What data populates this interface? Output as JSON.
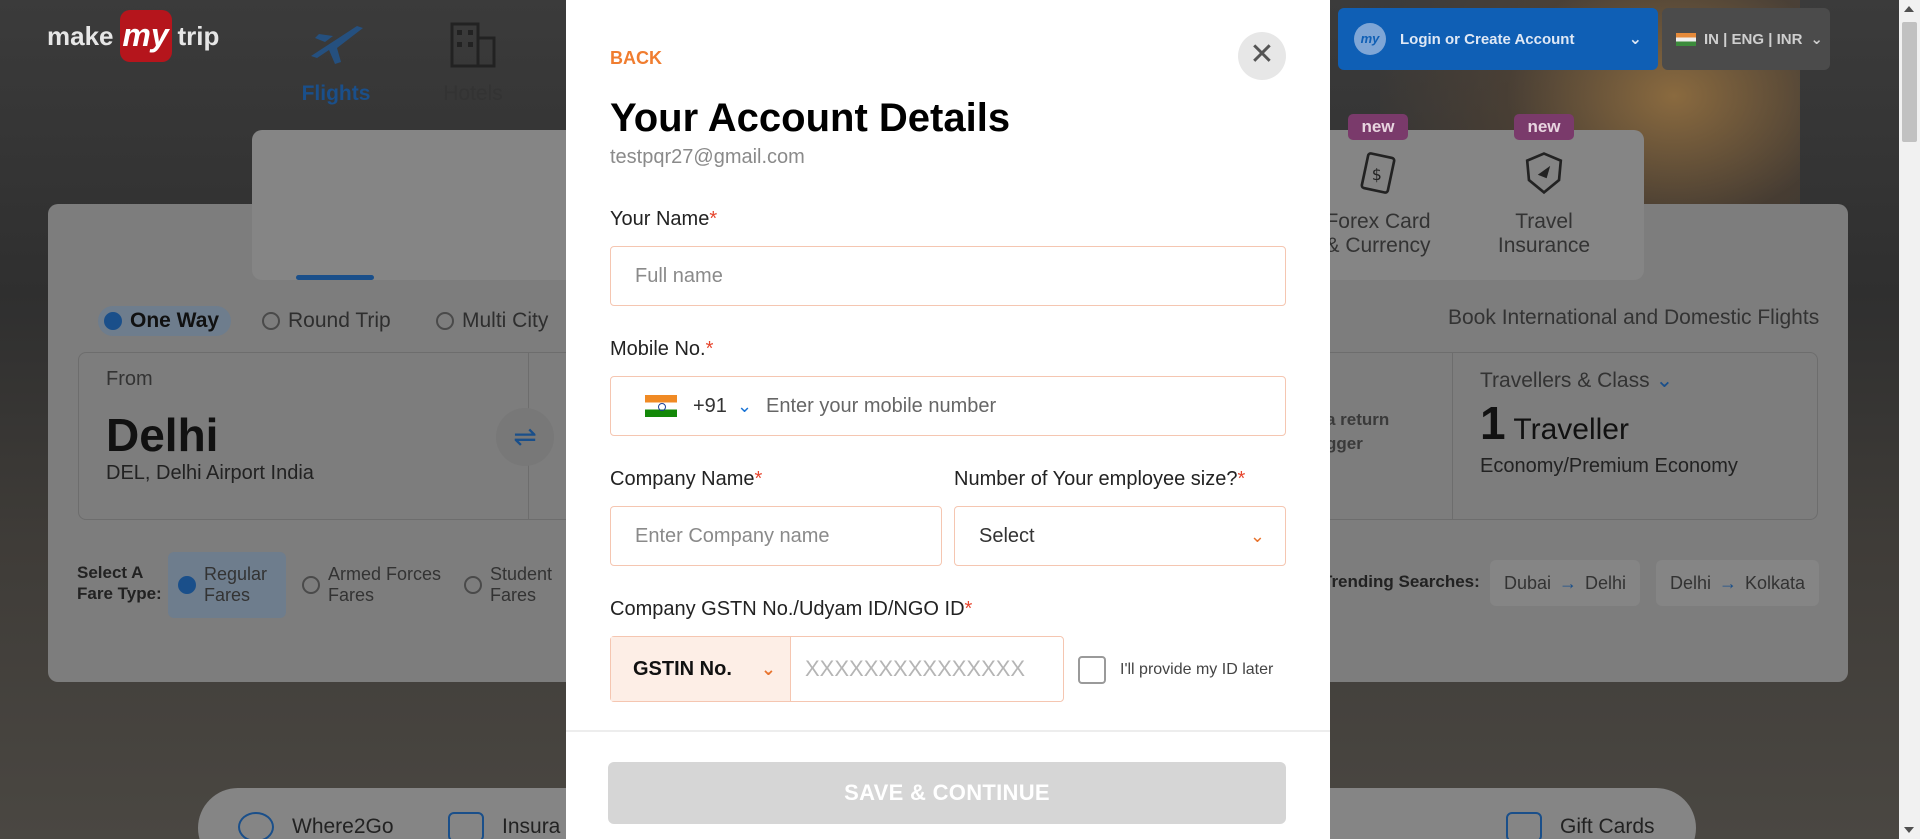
{
  "background": {
    "logo": {
      "left": "make",
      "mid": "my",
      "right": "trip"
    },
    "login": {
      "label": "Login or Create Account",
      "icon_text": "my"
    },
    "locale": {
      "label": "IN | ENG | INR"
    },
    "tabs": [
      {
        "label": "Flights"
      },
      {
        "label": "Hotels"
      }
    ],
    "tabs_right": [
      {
        "label_line1": "Forex Card",
        "label_line2": "& Currency",
        "badge": "new"
      },
      {
        "label_line1": "Travel",
        "label_line2": "Insurance",
        "badge": "new"
      }
    ],
    "trip_types": [
      "One Way",
      "Round Trip",
      "Multi City"
    ],
    "book_intl": "Book International and Domestic Flights",
    "from": {
      "label": "From",
      "city": "Delhi",
      "sub": "DEL, Delhi Airport India"
    },
    "return_hint": {
      "line1": "a return",
      "line2": "gger"
    },
    "travellers": {
      "label": "Travellers & Class",
      "count": "1",
      "unit": "Traveller",
      "class": "Economy/Premium Economy"
    },
    "fare": {
      "label_line1": "Select A",
      "label_line2": "Fare Type:",
      "options": [
        {
          "line1": "Regular",
          "line2": "Fares"
        },
        {
          "line1": "Armed Forces",
          "line2": "Fares"
        },
        {
          "line1": "Student",
          "line2": "Fares"
        }
      ]
    },
    "trending": {
      "label": "Trending Searches:",
      "chips": [
        {
          "from": "Dubai",
          "to": "Delhi"
        },
        {
          "from": "Delhi",
          "to": "Kolkata"
        }
      ]
    },
    "bottom": [
      {
        "label": "Where2Go"
      },
      {
        "label": "Insura"
      },
      {
        "label": "Gift Cards"
      }
    ],
    "arrow": "→"
  },
  "modal": {
    "back": "BACK",
    "close": "✕",
    "title": "Your Account Details",
    "email": "testpqr27@gmail.com",
    "name_label": "Your Name",
    "name_placeholder": "Full name",
    "mobile_label": "Mobile No.",
    "country_code": "+91",
    "mobile_placeholder": "Enter your mobile number",
    "company_label": "Company Name",
    "company_placeholder": "Enter Company name",
    "employee_label": "Number of Your employee size?",
    "employee_value": "Select",
    "gstin_label": "Company GSTN No./Udyam ID/NGO ID",
    "gstin_type": "GSTIN No.",
    "gstin_placeholder": "XXXXXXXXXXXXXXX",
    "later_label": "I'll provide my ID later",
    "save_label": "SAVE & CONTINUE",
    "required_mark": "*"
  },
  "colors": {
    "accent": "#f07d30",
    "brand_blue": "#0f5fb5",
    "input_border": "#f5c6b1",
    "disabled": "#d6d6d6"
  }
}
